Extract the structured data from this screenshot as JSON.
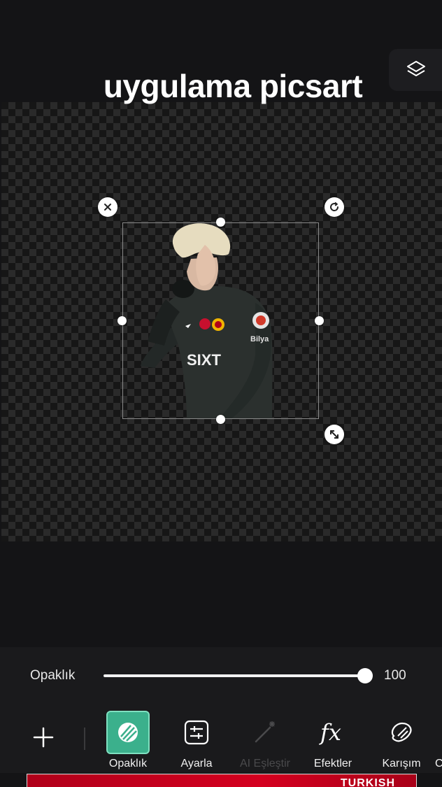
{
  "overlay": {
    "title": "uygulama picsart"
  },
  "toolbar_top": {
    "layers_icon": "layers-icon"
  },
  "canvas": {
    "sticker_text_logo": "SIXT",
    "sticker_sleeve_text": "Bilya"
  },
  "opacity": {
    "label": "Opaklık",
    "value": "100",
    "fraction": 1.0
  },
  "tools": [
    {
      "label": "Opaklık",
      "icon": "opacity-icon",
      "active": true,
      "disabled": false
    },
    {
      "label": "Ayarla",
      "icon": "adjust-icon",
      "active": false,
      "disabled": false
    },
    {
      "label": "AI Eşleştir",
      "icon": "magic-wand-icon",
      "active": false,
      "disabled": true
    },
    {
      "label": "Efektler",
      "icon": "fx-icon",
      "active": false,
      "disabled": false
    },
    {
      "label": "Karışım",
      "icon": "blend-icon",
      "active": false,
      "disabled": false
    }
  ],
  "tool_overflow_label": "C",
  "ad": {
    "text": "TURKISH"
  },
  "colors": {
    "accent": "#3bb08c",
    "background": "#141416",
    "ad_red": "#d4001f"
  }
}
